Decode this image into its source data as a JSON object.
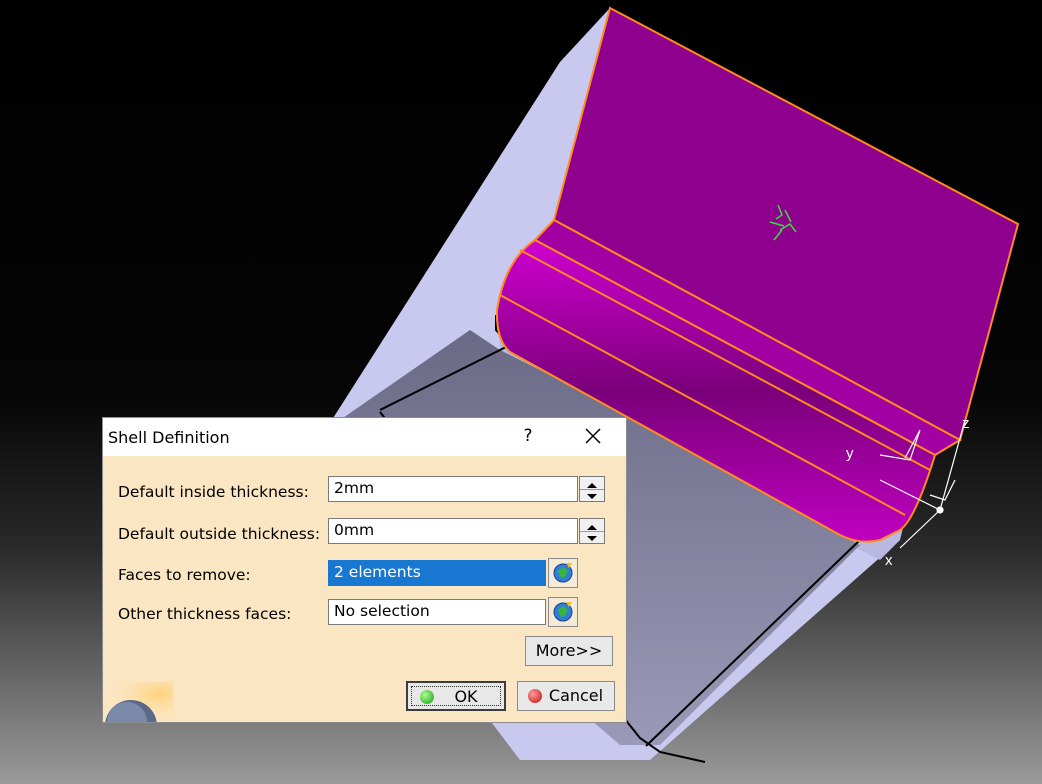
{
  "viewport": {
    "axis_labels": {
      "x": "x",
      "y": "y",
      "z": "z"
    },
    "colors": {
      "background_top": "#000000",
      "face_magenta": "#8f008f",
      "edge_orange": "#ff8a1e",
      "body_lavender": "#c8c8f0"
    }
  },
  "dialog": {
    "title": "Shell Definition",
    "help_label": "?",
    "rows": [
      {
        "label": "Default inside thickness:",
        "value": "2mm"
      },
      {
        "label": "Default outside thickness:",
        "value": "0mm"
      },
      {
        "label": "Faces to remove:",
        "value": "2 elements"
      },
      {
        "label": "Other thickness faces:",
        "value": "No selection"
      }
    ],
    "more_label": "More>>",
    "ok_label": "OK",
    "cancel_label": "Cancel"
  }
}
